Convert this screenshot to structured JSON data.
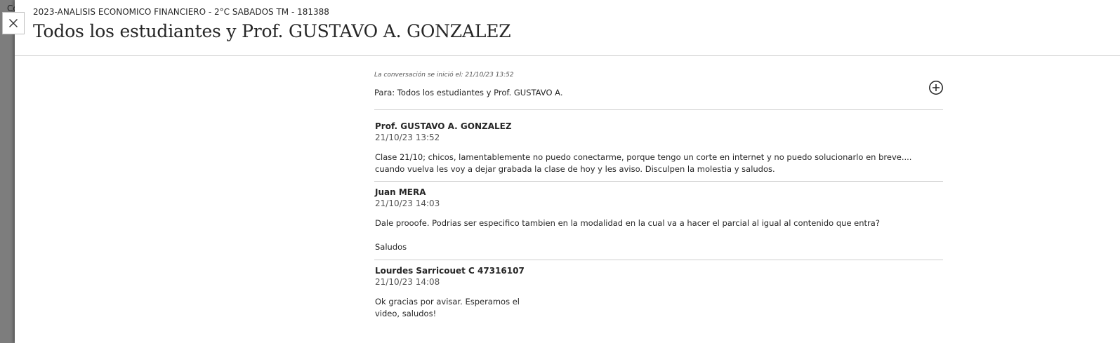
{
  "backdrop": {
    "text": "Co"
  },
  "header": {
    "course": "2023-ANALISIS ECONOMICO FINANCIERO - 2°C SABADOS TM - 181388",
    "title": "Todos los estudiantes y Prof. GUSTAVO A. GONZALEZ",
    "close_icon": "close-icon"
  },
  "conversation": {
    "started": "La conversación se inició el: 21/10/23 13:52",
    "to": "Para: Todos los estudiantes y Prof. GUSTAVO A.",
    "add_icon": "plus-circle-icon"
  },
  "messages": [
    {
      "author": "Prof. GUSTAVO A. GONZALEZ",
      "date": "21/10/23 13:52",
      "paragraphs": [
        "Clase 21/10; chicos, lamentablemente no puedo conectarme, porque tengo un corte en internet y no puedo solucionarlo en breve.... cuando vuelva les voy a dejar grabada la clase de hoy y les aviso. Disculpen la molestia y saludos."
      ]
    },
    {
      "author": "Juan MERA",
      "date": "21/10/23 14:03",
      "paragraphs": [
        "Dale prooofe. Podrias ser especifico tambien en la modalidad en la cual va a hacer el parcial al igual al contenido que entra?",
        "Saludos"
      ]
    },
    {
      "author": "Lourdes Sarricouet C 47316107",
      "date": "21/10/23 14:08",
      "paragraphs": [
        "Ok gracias por avisar. Esperamos el",
        "video, saludos!"
      ]
    }
  ],
  "colors": {
    "text": "#262626",
    "muted": "#555555",
    "divider": "#cfcfcf",
    "backdrop": "#7d7d7d"
  }
}
